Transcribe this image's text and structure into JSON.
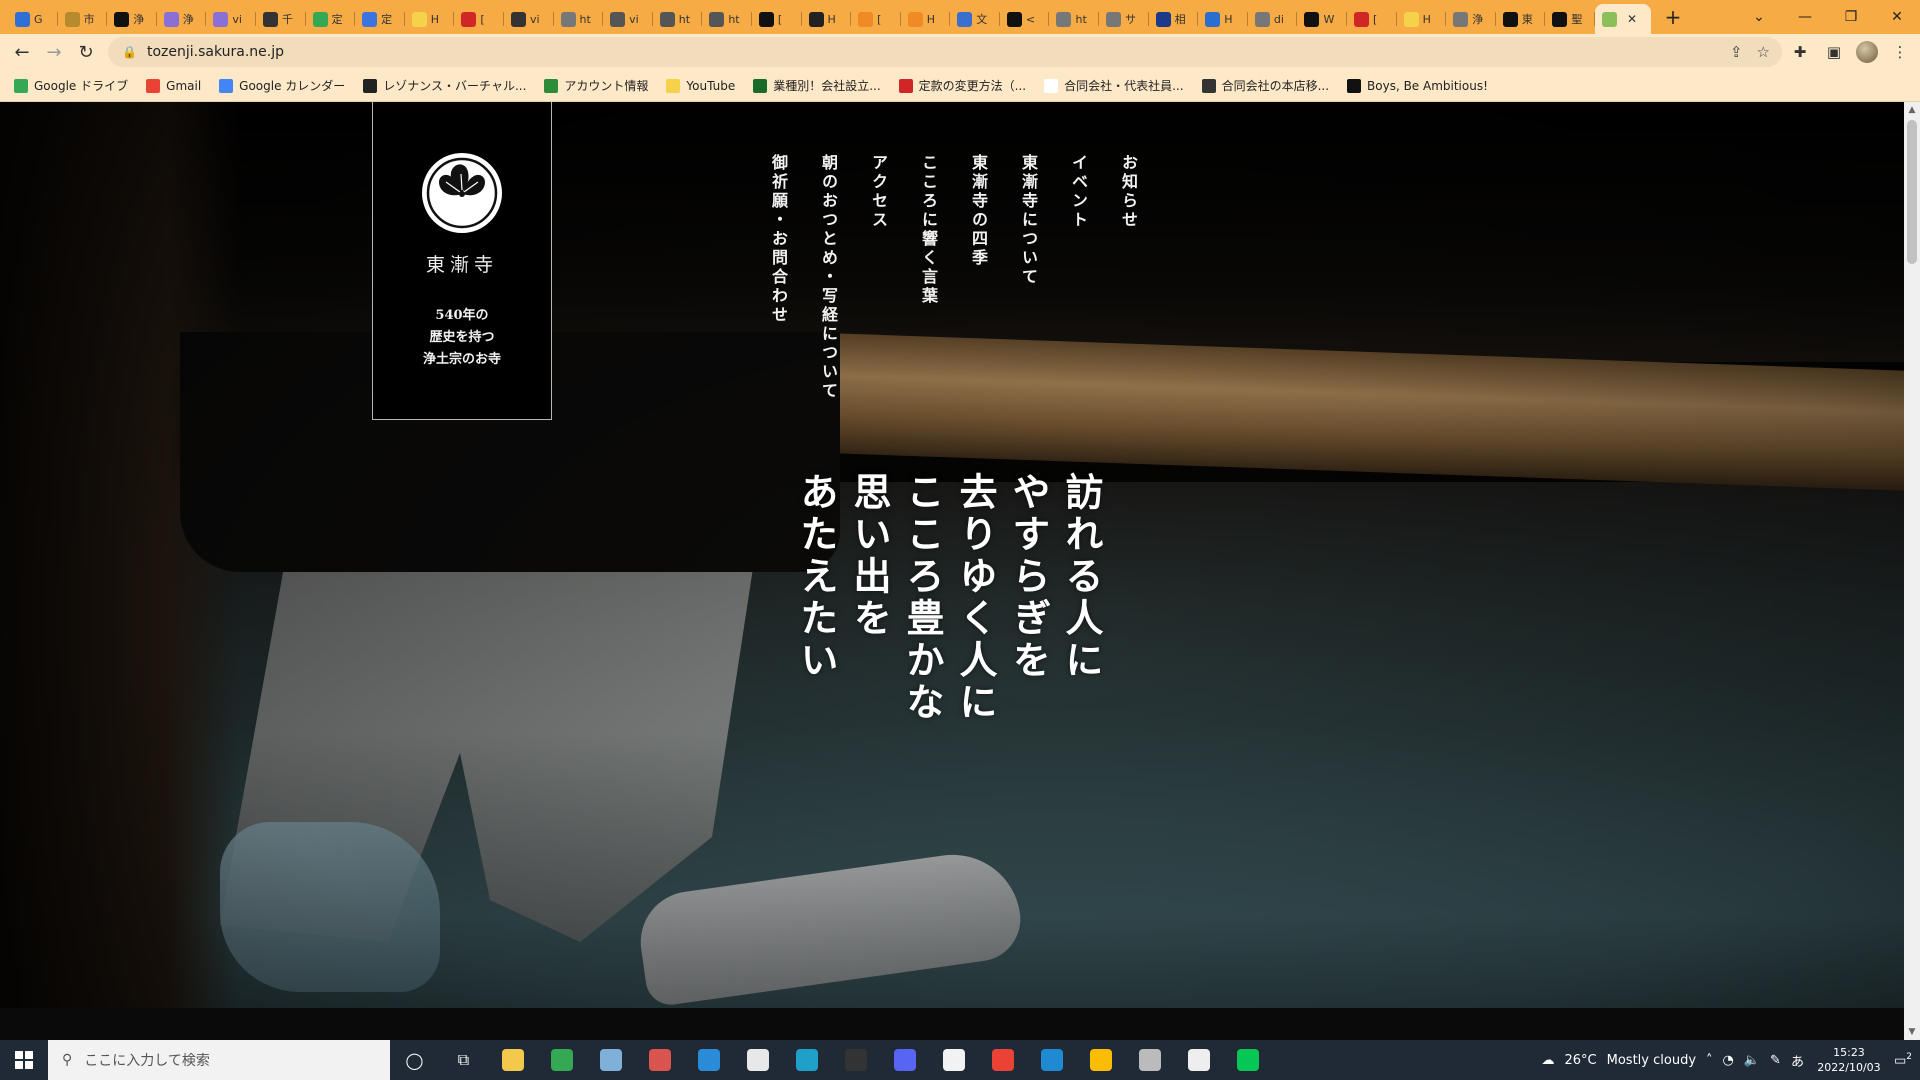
{
  "browser": {
    "tabs": [
      {
        "title": "G",
        "color": "#2f6fd6"
      },
      {
        "title": "市",
        "color": "#b88a2e"
      },
      {
        "title": "浄",
        "color": "#111111"
      },
      {
        "title": "浄",
        "color": "#8a6fd6"
      },
      {
        "title": "vi",
        "color": "#8a6fd6"
      },
      {
        "title": "千",
        "color": "#333333"
      },
      {
        "title": "定",
        "color": "#34a853"
      },
      {
        "title": "定",
        "color": "#3b73e0"
      },
      {
        "title": "H",
        "color": "#f6d24a"
      },
      {
        "title": "[",
        "color": "#d02626"
      },
      {
        "title": "vi",
        "color": "#333333"
      },
      {
        "title": "ht",
        "color": "#777777"
      },
      {
        "title": "vi",
        "color": "#555555"
      },
      {
        "title": "ht",
        "color": "#555555"
      },
      {
        "title": "ht",
        "color": "#555555"
      },
      {
        "title": "[",
        "color": "#111111"
      },
      {
        "title": "H",
        "color": "#222222"
      },
      {
        "title": "[",
        "color": "#f08a24"
      },
      {
        "title": "H",
        "color": "#f08a24"
      },
      {
        "title": "文",
        "color": "#3a6fd0"
      },
      {
        "title": "<",
        "color": "#111111"
      },
      {
        "title": "ht",
        "color": "#777777"
      },
      {
        "title": "サ",
        "color": "#777777"
      },
      {
        "title": "相",
        "color": "#1a3a8a"
      },
      {
        "title": "H",
        "color": "#2a6fd0"
      },
      {
        "title": "di",
        "color": "#777777"
      },
      {
        "title": "W",
        "color": "#111111"
      },
      {
        "title": "[",
        "color": "#d02626"
      },
      {
        "title": "H",
        "color": "#f6d24a"
      },
      {
        "title": "浄",
        "color": "#777777"
      },
      {
        "title": "東",
        "color": "#111111"
      },
      {
        "title": "聖",
        "color": "#111111"
      },
      {
        "title": "",
        "color": "#8bbf5a",
        "active": true
      }
    ],
    "close_tab_symbol": "✕",
    "new_tab_symbol": "+",
    "url": "tozenji.sakura.ne.jp",
    "bookmarks": [
      {
        "label": "Google ドライブ",
        "color": "#34a853"
      },
      {
        "label": "Gmail",
        "color": "#ea4335"
      },
      {
        "label": "Google カレンダー",
        "color": "#4285f4"
      },
      {
        "label": "レゾナンス・バーチャル...",
        "color": "#222222"
      },
      {
        "label": "アカウント情報",
        "color": "#2e8b3a"
      },
      {
        "label": "YouTube",
        "color": "#f6d24a"
      },
      {
        "label": "業種別！会社設立...",
        "color": "#1a6b2a"
      },
      {
        "label": "定款の変更方法（...",
        "color": "#d02626"
      },
      {
        "label": "合同会社・代表社員...",
        "color": "#ffffff"
      },
      {
        "label": "合同会社の本店移...",
        "color": "#333333"
      },
      {
        "label": "Boys, Be Ambitious!",
        "color": "#111111"
      }
    ]
  },
  "site": {
    "temple_name": "東漸寺",
    "tagline": [
      "540年の",
      "歴史を持つ",
      "浄土宗のお寺"
    ],
    "nav": [
      "お知らせ",
      "イベント",
      "東漸寺について",
      "東漸寺の四季",
      "こころに響く言葉",
      "アクセス",
      "朝のおつとめ・写経について",
      "御祈願・お問合わせ"
    ],
    "poem": [
      "訪れる人に",
      "やすらぎを",
      "去りゆく人に",
      "こころ豊かな",
      "思い出を",
      "あたえたい"
    ]
  },
  "taskbar": {
    "search_placeholder": "ここに入力して検索",
    "weather_temp": "26°C",
    "weather_text": "Mostly cloudy",
    "ime": "あ",
    "time": "15:23",
    "date": "2022/10/03",
    "notification_count": "2",
    "apps": [
      {
        "name": "file-explorer",
        "color": "#f2c94c"
      },
      {
        "name": "chrome-profile",
        "color": "#34a853"
      },
      {
        "name": "notes",
        "color": "#7fb0d8"
      },
      {
        "name": "app-red",
        "color": "#d9534f"
      },
      {
        "name": "mail",
        "color": "#2a8bd6"
      },
      {
        "name": "doc",
        "color": "#e8e8e8"
      },
      {
        "name": "edge",
        "color": "#1fa0c8"
      },
      {
        "name": "terminal",
        "color": "#333333"
      },
      {
        "name": "discord",
        "color": "#5865f2"
      },
      {
        "name": "notepad",
        "color": "#f2f2f2"
      },
      {
        "name": "chrome",
        "color": "#ea4335"
      },
      {
        "name": "vscode",
        "color": "#1f8ad2"
      },
      {
        "name": "chrome-2",
        "color": "#fbbc05"
      },
      {
        "name": "app-gray",
        "color": "#bbbbbb"
      },
      {
        "name": "app-white",
        "color": "#eeeeee"
      },
      {
        "name": "line",
        "color": "#06c755"
      }
    ]
  }
}
